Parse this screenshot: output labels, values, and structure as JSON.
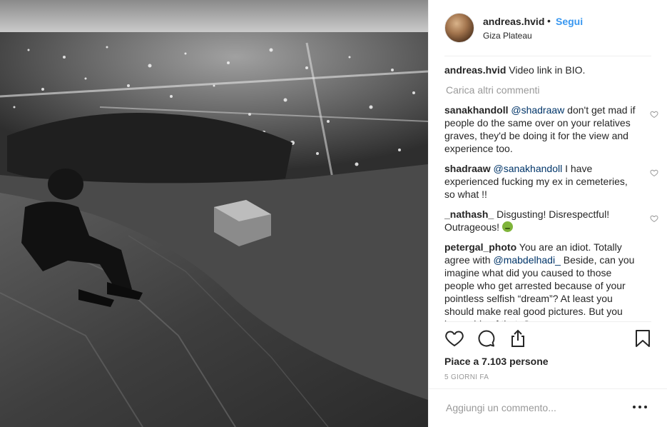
{
  "photo": {
    "alt_icon": "night-city-photo"
  },
  "post": {
    "username": "andreas.hvid",
    "separator": "•",
    "follow_label": "Segui",
    "location": "Giza Plateau"
  },
  "caption": {
    "user": "andreas.hvid",
    "text": "Video link in BIO."
  },
  "load_more_label": "Carica altri commenti",
  "comments": [
    {
      "user": "sanakhandoll",
      "mention": "@shadraaw",
      "text": " don't get mad if people do the same over on your relatives graves, they'd be doing it for the view and experience too."
    },
    {
      "user": "shadraaw",
      "mention": "@sanakhandoll",
      "text": " I have experienced fucking my ex in cemeteries, so what !!"
    },
    {
      "user": "_nathash_",
      "text": "Disgusting! Disrespectful! Outrageous!"
    },
    {
      "user": "petergal_photo",
      "text_a": "You are an idiot. Totally agree with ",
      "mention": "@mabdelhadi_",
      "text_b": " Beside, can you imagine what did you caused to those people who get arrested because of your pointless selfish “dream”? At least you should make real good pictures. But you incapable of that. So"
    }
  ],
  "likes": "Piace a 7.103 persone",
  "time": "5 GIORNI FA",
  "add_comment_placeholder": "Aggiungi un commento...",
  "more_label": "•••",
  "colors": {
    "link": "#3897f0",
    "mention": "#003569",
    "muted": "#999999",
    "text": "#262626"
  }
}
